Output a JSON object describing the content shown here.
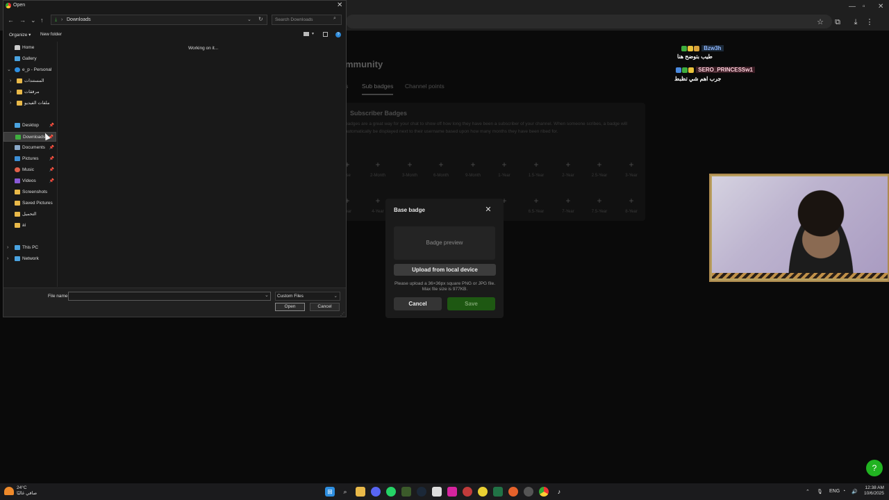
{
  "dialog": {
    "title": "Open",
    "path": "Downloads",
    "search_placeholder": "Search Downloads",
    "organize": "Organize",
    "new_folder": "New folder",
    "status": "Working on it...",
    "nav": {
      "home": "Home",
      "gallery": "Gallery",
      "onedrive": "e_p - Personal",
      "documents_ar": "المستندات",
      "attachments_ar": "مرفقات",
      "videos_ar": "ملفات الفيديو",
      "desktop": "Desktop",
      "downloads": "Downloads",
      "documents": "Documents",
      "pictures": "Pictures",
      "music": "Music",
      "videos": "Videos",
      "screenshots": "Screenshots",
      "saved_pictures": "Saved Pictures",
      "downloads_ar": "التحميل",
      "ai": "ai",
      "this_pc": "This PC",
      "network": "Network"
    },
    "file_name_label": "File name:",
    "file_name_value": "",
    "file_type": "Custom Files",
    "open_label": "Open",
    "cancel_label": "Cancel"
  },
  "background_page": {
    "title": "mmunity",
    "tabs": [
      "s",
      "Sub badges",
      "Channel points"
    ],
    "card_title": "Subscriber Badges",
    "card_desc": "badges are a great way for your chat to show off how long they have been a subscriber of your channel. When someone scribes, a badge will automatically be displayed next to their username based upon how many months they have been ribed for.",
    "row1": [
      "ase",
      "2-Month",
      "3-Month",
      "6-Month",
      "9-Month",
      "1-Year",
      "1.5-Year",
      "2-Year",
      "2.5-Year",
      "3-Year"
    ],
    "row2": [
      "Year",
      "4-Year",
      "",
      "",
      "",
      "",
      "6.5-Year",
      "7-Year",
      "7.5-Year",
      "8-Year"
    ]
  },
  "modal": {
    "title": "Base badge",
    "preview": "Badge preview",
    "upload": "Upload from local device",
    "hint": "Please upload a 36×36px square PNG or JPG file. Max file size is 977KB.",
    "cancel": "Cancel",
    "save": "Save"
  },
  "chat": [
    {
      "user": "Bzw3h",
      "message": "طيب بتوضح هنا",
      "color": "#8fb7ff"
    },
    {
      "user": "SERO_PRINCESSw1",
      "message": "جرب اهم شي تظبط",
      "color": "#ffb7c9"
    }
  ],
  "taskbar": {
    "temp": "24°C",
    "weather": "صافي غالبًا",
    "lang": "ENG",
    "time": "12:38 AM",
    "date": "10/6/2025"
  },
  "colors": {
    "accent_green": "#21b321",
    "save_green": "#1e5812"
  }
}
